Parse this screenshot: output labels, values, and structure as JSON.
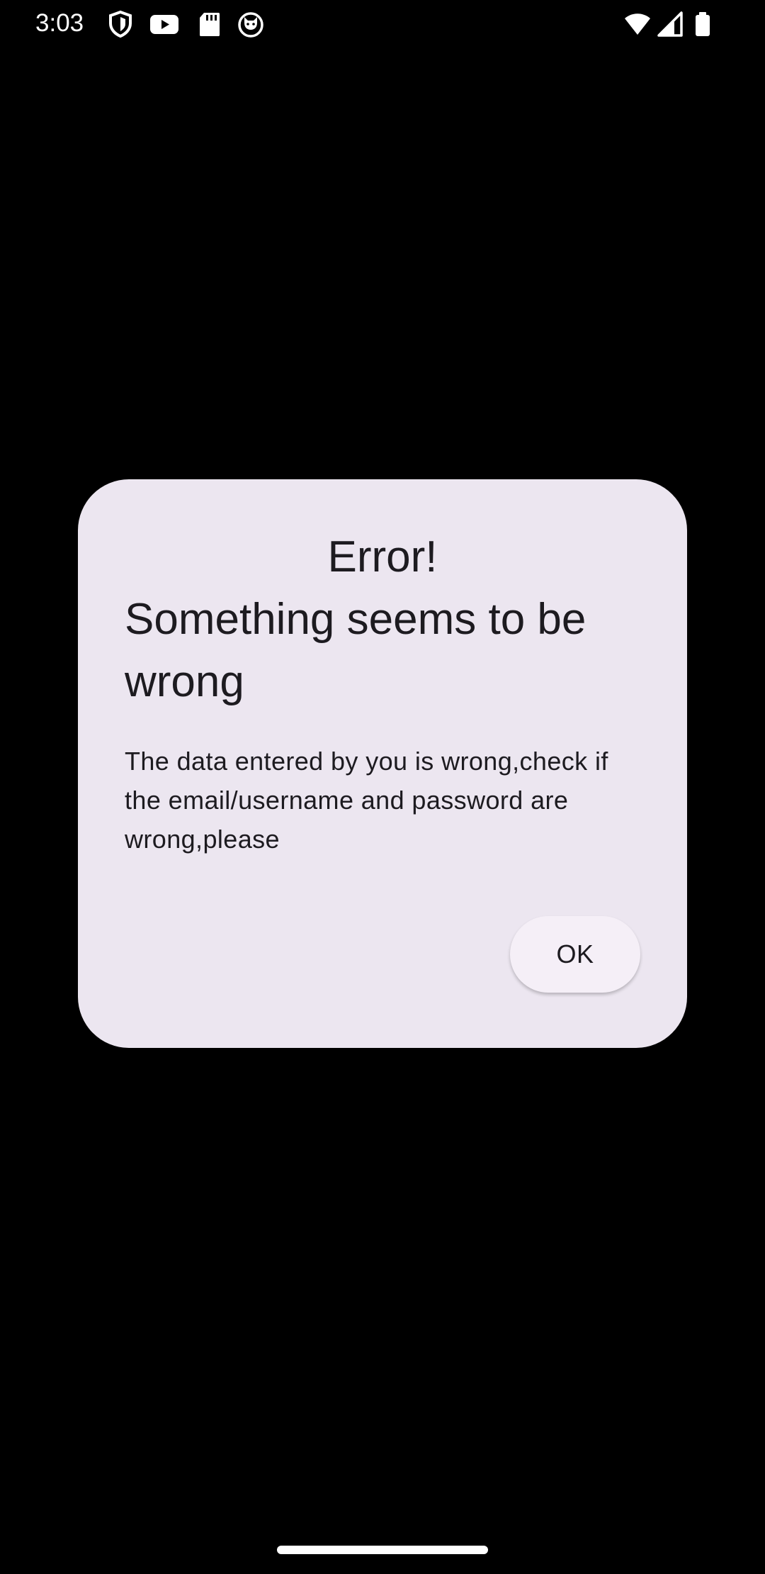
{
  "status_bar": {
    "time": "3:03",
    "left_icons": [
      "shield-icon",
      "youtube-icon",
      "sd-card-icon",
      "cat-face-icon"
    ],
    "right_icons": [
      "wifi-icon",
      "cellular-signal-icon",
      "battery-icon"
    ]
  },
  "dialog": {
    "title_line1": "Error!",
    "title_line2": "Something seems to be",
    "title_line3": "wrong",
    "message": "The data entered by you is wrong,check if the email/username and password are wrong,please",
    "ok_label": "OK"
  },
  "colors": {
    "background": "#000000",
    "dialog_surface": "#ece6f0",
    "button_surface": "#f5eff7",
    "text": "#1d1b20"
  }
}
